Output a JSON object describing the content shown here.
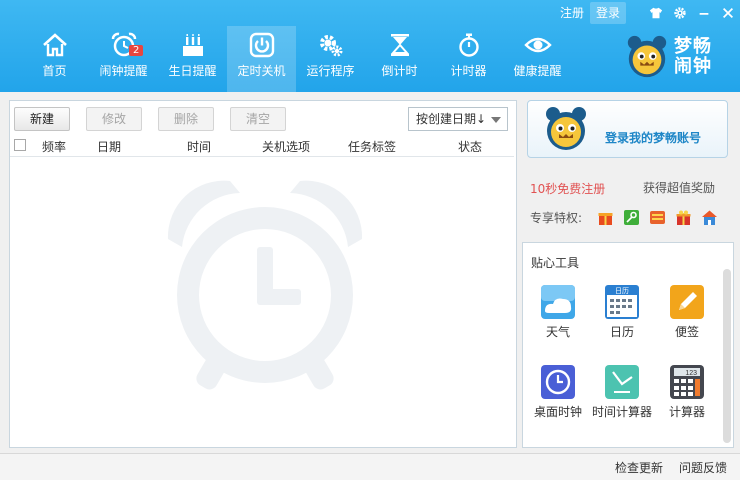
{
  "window": {
    "register_link": "注册",
    "login_link": "登录"
  },
  "nav": [
    {
      "label": "首页",
      "icon": "home-icon"
    },
    {
      "label": "闹钟提醒",
      "icon": "alarm-clock-icon",
      "badge": "2"
    },
    {
      "label": "生日提醒",
      "icon": "birthday-cake-icon"
    },
    {
      "label": "定时关机",
      "icon": "power-icon",
      "active": true
    },
    {
      "label": "运行程序",
      "icon": "gears-icon"
    },
    {
      "label": "倒计时",
      "icon": "hourglass-icon"
    },
    {
      "label": "计时器",
      "icon": "stopwatch-icon"
    },
    {
      "label": "健康提醒",
      "icon": "eye-icon"
    }
  ],
  "brand": {
    "line1": "梦畅",
    "line2": "闹钟"
  },
  "toolbar": {
    "new_label": "新建",
    "edit_label": "修改",
    "delete_label": "删除",
    "clear_label": "清空",
    "sort_label": "按创建日期↓"
  },
  "table": {
    "columns": [
      "频率",
      "日期",
      "时间",
      "关机选项",
      "任务标签",
      "状态"
    ],
    "rows": []
  },
  "account": {
    "login_prompt": "登录我的梦畅账号",
    "register_prompt": "10秒免费注册",
    "reward_text": "获得超值奖励",
    "privileges_label": "专享特权:"
  },
  "tools": {
    "title": "贴心工具",
    "items": [
      {
        "label": "天气",
        "icon": "weather-icon"
      },
      {
        "label": "日历",
        "icon": "calendar-icon",
        "icon_text": "日历"
      },
      {
        "label": "便签",
        "icon": "note-icon"
      },
      {
        "label": "桌面时钟",
        "icon": "desktop-clock-icon"
      },
      {
        "label": "时间计算器",
        "icon": "time-calculator-icon"
      },
      {
        "label": "计算器",
        "icon": "calculator-icon",
        "icon_text": "123"
      }
    ]
  },
  "status": {
    "check_update": "检查更新",
    "feedback": "问题反馈"
  },
  "colors": {
    "header": "#28a8ec",
    "accent_red": "#e15252",
    "link_blue": "#1e86c7"
  }
}
